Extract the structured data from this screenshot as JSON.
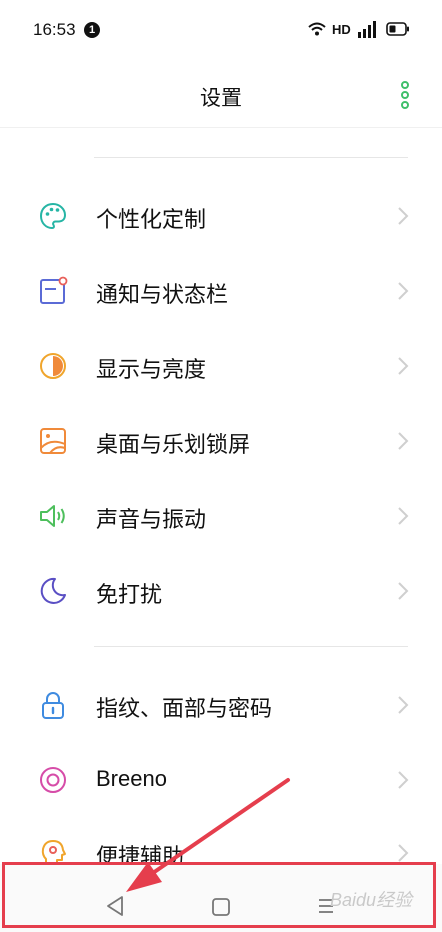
{
  "status_bar": {
    "time": "16:53",
    "notification_count": "1",
    "network_label": "HD"
  },
  "header": {
    "title": "设置"
  },
  "sections": [
    {
      "items": [
        {
          "label": "个性化定制",
          "icon": "palette-icon",
          "color": "#26b5a5"
        },
        {
          "label": "通知与状态栏",
          "icon": "notification-icon",
          "color": "#5b6bd6"
        },
        {
          "label": "显示与亮度",
          "icon": "brightness-icon",
          "color": "#f0a52c"
        },
        {
          "label": "桌面与乐划锁屏",
          "icon": "wallpaper-icon",
          "color": "#f08a3a"
        },
        {
          "label": "声音与振动",
          "icon": "speaker-icon",
          "color": "#4dbf5c"
        },
        {
          "label": "免打扰",
          "icon": "moon-icon",
          "color": "#5a4fc4"
        }
      ]
    },
    {
      "items": [
        {
          "label": "指纹、面部与密码",
          "icon": "lock-icon",
          "color": "#3f8be0"
        },
        {
          "label": "Breeno",
          "icon": "breeno-icon",
          "color": "#d64ca8"
        },
        {
          "label": "便捷辅助",
          "icon": "assist-icon",
          "color": "#f0a52c"
        }
      ]
    }
  ],
  "watermark": "Baidu经验",
  "colors": {
    "accent_green": "#3fbf6a",
    "annotation_red": "#e53e4d"
  }
}
